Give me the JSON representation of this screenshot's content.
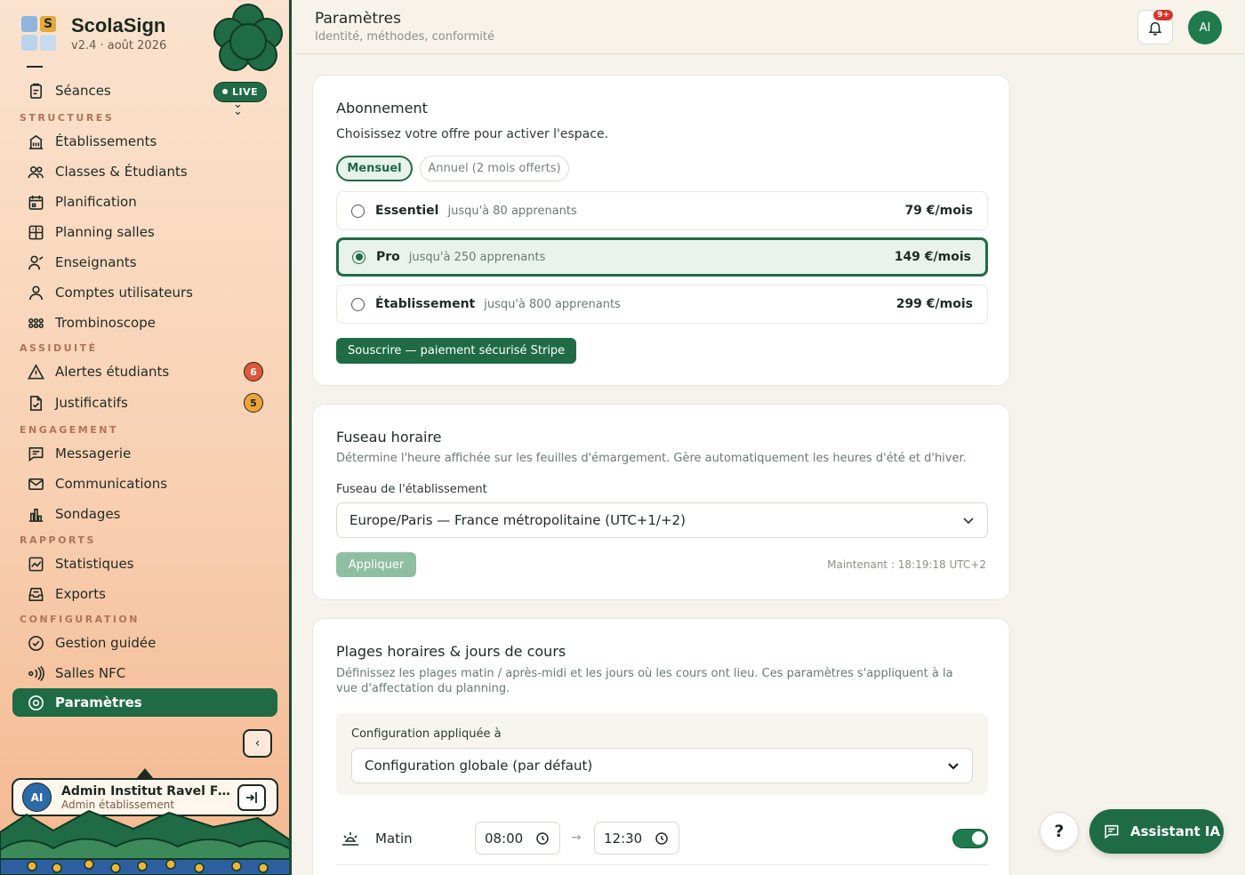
{
  "brand": {
    "name": "ScolaSign",
    "version": "v2.4 · août 2026",
    "logo_letter": "S",
    "live": "LIVE"
  },
  "sidebar": {
    "items": [
      {
        "label": "Séances",
        "icon": "clipboard-icon"
      },
      {
        "label": "Établissements",
        "icon": "building-icon"
      },
      {
        "label": "Classes & Étudiants",
        "icon": "users-icon"
      },
      {
        "label": "Planification",
        "icon": "calendar-icon"
      },
      {
        "label": "Planning salles",
        "icon": "grid-icon"
      },
      {
        "label": "Enseignants",
        "icon": "teacher-icon"
      },
      {
        "label": "Comptes utilisateurs",
        "icon": "user-icon"
      },
      {
        "label": "Trombinoscope",
        "icon": "faces-icon"
      },
      {
        "label": "Alertes étudiants",
        "icon": "warning-icon",
        "badge": "6"
      },
      {
        "label": "Justificatifs",
        "icon": "document-check-icon",
        "badge": "5"
      },
      {
        "label": "Messagerie",
        "icon": "message-icon"
      },
      {
        "label": "Communications",
        "icon": "mail-icon"
      },
      {
        "label": "Sondages",
        "icon": "bar-chart-icon"
      },
      {
        "label": "Statistiques",
        "icon": "line-chart-icon"
      },
      {
        "label": "Exports",
        "icon": "inbox-icon"
      },
      {
        "label": "Gestion guidée",
        "icon": "check-circle-icon"
      },
      {
        "label": "Salles NFC",
        "icon": "nfc-icon"
      },
      {
        "label": "Paramètres",
        "icon": "settings-icon"
      }
    ],
    "sections": [
      "STRUCTURES",
      "ASSIDUITÉ",
      "ENGAGEMENT",
      "RAPPORTS",
      "CONFIGURATION"
    ],
    "user": {
      "initials": "AI",
      "name": "Admin Institut Ravel For...",
      "role": "Admin établissement"
    }
  },
  "header": {
    "title": "Paramètres",
    "subtitle": "Identité, méthodes, conformité",
    "notif_count": "9+",
    "avatar": "AI"
  },
  "subscription": {
    "title": "Abonnement",
    "subtitle": "Choisissez votre offre pour activer l'espace.",
    "tabs": [
      "Mensuel",
      "Annuel (2 mois offerts)"
    ],
    "plans": [
      {
        "name": "Essentiel",
        "desc": "jusqu'à 80 apprenants",
        "price": "79 €/mois"
      },
      {
        "name": "Pro",
        "desc": "jusqu'à 250 apprenants",
        "price": "149 €/mois"
      },
      {
        "name": "Établissement",
        "desc": "jusqu'à 800 apprenants",
        "price": "299 €/mois"
      }
    ],
    "selected_plan": "Pro",
    "cta": "Souscrire — paiement sécurisé Stripe"
  },
  "timezone": {
    "title": "Fuseau horaire",
    "subtitle": "Détermine l'heure affichée sur les feuilles d'émargement. Gère automatiquement les heures d'été et d'hiver.",
    "field_label": "Fuseau de l'établissement",
    "value": "Europe/Paris — France métropolitaine (UTC+1/+2)",
    "apply": "Appliquer",
    "now": "Maintenant : 18:19:18 UTC+2"
  },
  "slots": {
    "title": "Plages horaires & jours de cours",
    "subtitle": "Définissez les plages matin / après-midi et les jours où les cours ont lieu. Ces paramètres s'appliquent à la vue d'affectation du planning.",
    "config_label": "Configuration appliquée à",
    "config_value": "Configuration globale (par défaut)",
    "morning": {
      "label": "Matin",
      "start": "08:00",
      "end": "12:30",
      "enabled": true
    }
  },
  "fab": {
    "help": "?",
    "assistant": "Assistant IA"
  },
  "colors": {
    "accent": "#1f6b45",
    "alert": "#e0573a",
    "warning": "#f0a23a"
  }
}
